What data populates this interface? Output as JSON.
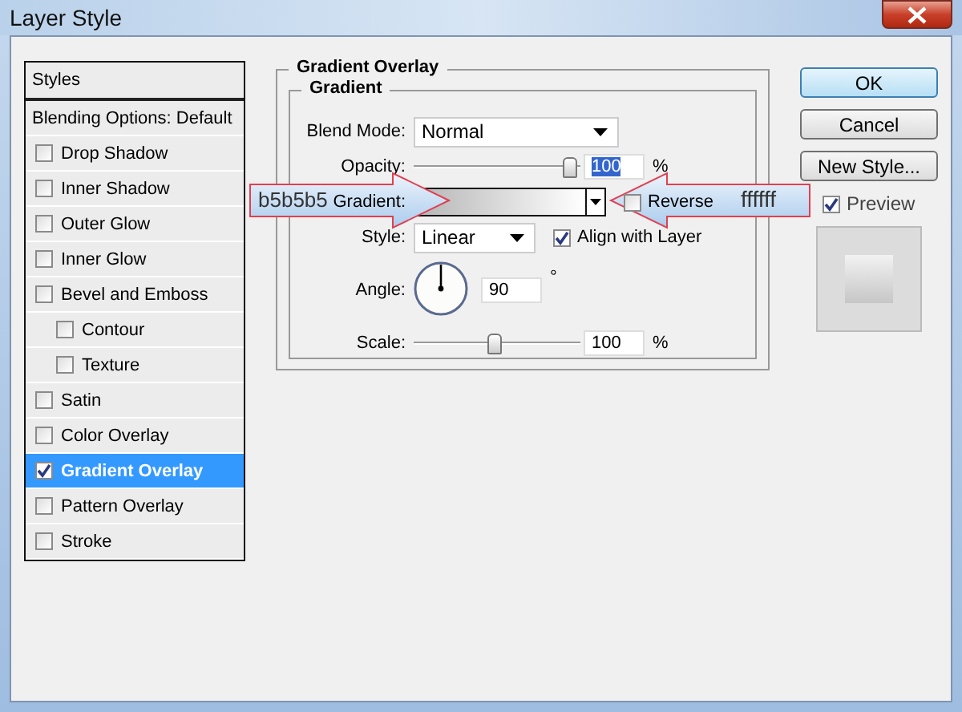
{
  "window": {
    "title": "Layer Style"
  },
  "styles_panel": {
    "header": "Styles",
    "blending_options": "Blending Options: Default",
    "effects": [
      {
        "label": "Drop Shadow",
        "checked": false,
        "selected": false
      },
      {
        "label": "Inner Shadow",
        "checked": false,
        "selected": false
      },
      {
        "label": "Outer Glow",
        "checked": false,
        "selected": false
      },
      {
        "label": "Inner Glow",
        "checked": false,
        "selected": false
      },
      {
        "label": "Bevel and Emboss",
        "checked": false,
        "selected": false,
        "children": [
          {
            "label": "Contour",
            "checked": false,
            "selected": false
          },
          {
            "label": "Texture",
            "checked": false,
            "selected": false
          }
        ]
      },
      {
        "label": "Satin",
        "checked": false,
        "selected": false
      },
      {
        "label": "Color Overlay",
        "checked": false,
        "selected": false
      },
      {
        "label": "Gradient Overlay",
        "checked": true,
        "selected": true
      },
      {
        "label": "Pattern Overlay",
        "checked": false,
        "selected": false
      },
      {
        "label": "Stroke",
        "checked": false,
        "selected": false
      }
    ]
  },
  "gradient_overlay": {
    "title": "Gradient Overlay",
    "group_title": "Gradient",
    "blend_mode": {
      "label": "Blend Mode:",
      "value": "Normal"
    },
    "opacity": {
      "label": "Opacity:",
      "level": 0.95,
      "value": "100",
      "unit": "%"
    },
    "gradient": {
      "label": "Gradient:"
    },
    "reverse": {
      "label": "Reverse",
      "checked": false
    },
    "style": {
      "label": "Style:",
      "value": "Linear"
    },
    "align_with_layer": {
      "label": "Align with Layer",
      "checked": true
    },
    "angle": {
      "label": "Angle:",
      "value": "90",
      "unit": "°"
    },
    "scale": {
      "label": "Scale:",
      "level": 0.5,
      "value": "100",
      "unit": "%"
    }
  },
  "buttons": [
    {
      "label": "OK",
      "default": true
    },
    {
      "label": "Cancel",
      "default": false
    },
    {
      "label": "New Style...",
      "default": false
    }
  ],
  "preview": {
    "label": "Preview",
    "checked": true
  },
  "callouts": [
    {
      "kind": "right",
      "text": "b5b5b5"
    },
    {
      "kind": "left",
      "text": "ffffff"
    }
  ]
}
